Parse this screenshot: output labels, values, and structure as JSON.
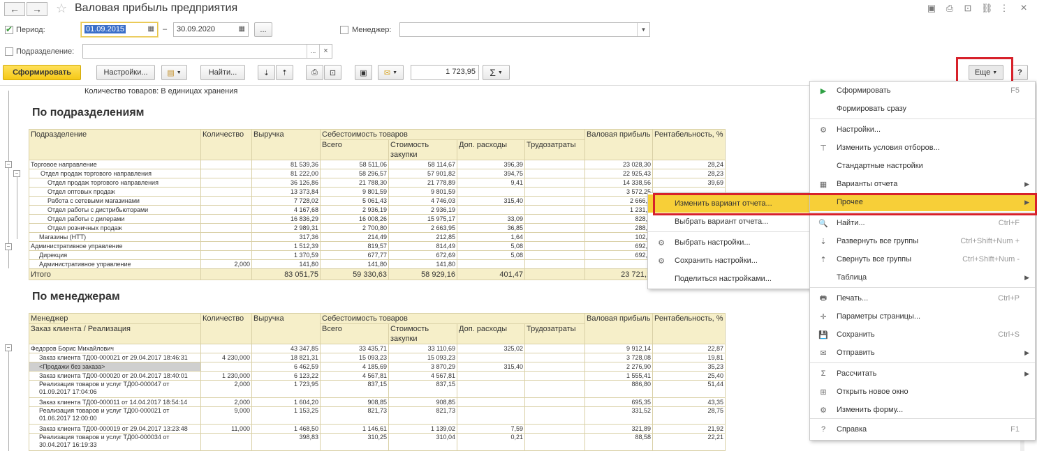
{
  "window": {
    "title": "Валовая прибыль предприятия"
  },
  "filters": {
    "period_label": "Период:",
    "date_from": "01.09.2015",
    "date_dash": "–",
    "date_to": "30.09.2020",
    "dots": "...",
    "manager_label": "Менеджер:",
    "manager_value": "",
    "division_label": "Подразделение:",
    "division_value": "",
    "clear": "×"
  },
  "toolbar": {
    "generate": "Сформировать",
    "settings": "Настройки...",
    "find": "Найти...",
    "sum_value": "1 723,95",
    "sigma": "Σ",
    "more": "Еще",
    "help": "?"
  },
  "report": {
    "note": "Количество товаров: В единицах хранения",
    "section1_title": "По подразделениям",
    "section2_title": "По менеджерам",
    "headers": {
      "division": "Подразделение",
      "manager": "Менеджер",
      "order": "Заказ клиента / Реализация",
      "qty": "Количество",
      "revenue": "Выручка",
      "cost": "Себестоимость товаров",
      "total": "Всего",
      "purchase": "Стоимость закупки",
      "extra": "Доп. расходы",
      "labor": "Трудозатраты",
      "gross": "Валовая прибыль",
      "profit": "Рентабельность, %"
    },
    "rows1": [
      {
        "lvl": "l0",
        "name": "Торговое направление",
        "qty": "",
        "rev": "81 539,36",
        "tot": "58 511,06",
        "pur": "58 114,67",
        "ext": "396,39",
        "lab": "",
        "gp": "23 028,30",
        "pct": "28,24"
      },
      {
        "lvl": "l1",
        "name": "Отдел продаж торгового направления",
        "qty": "",
        "rev": "81 222,00",
        "tot": "58 296,57",
        "pur": "57 901,82",
        "ext": "394,75",
        "lab": "",
        "gp": "22 925,43",
        "pct": "28,23"
      },
      {
        "lvl": "l2",
        "name": "Отдел продаж торгового направления",
        "qty": "",
        "rev": "36 126,86",
        "tot": "21 788,30",
        "pur": "21 778,89",
        "ext": "9,41",
        "lab": "",
        "gp": "14 338,56",
        "pct": "39,69"
      },
      {
        "lvl": "l2",
        "name": "Отдел оптовых продаж",
        "qty": "",
        "rev": "13 373,84",
        "tot": "9 801,59",
        "pur": "9 801,59",
        "ext": "",
        "lab": "",
        "gp": "3 572,25",
        "pct": ""
      },
      {
        "lvl": "l2",
        "name": "Работа с сетевыми магазинами",
        "qty": "",
        "rev": "7 728,02",
        "tot": "5 061,43",
        "pur": "4 746,03",
        "ext": "315,40",
        "lab": "",
        "gp": "2 666,5",
        "pct": ""
      },
      {
        "lvl": "l2",
        "name": "Отдел работы с дистрибьюторами",
        "qty": "",
        "rev": "4 167,68",
        "tot": "2 936,19",
        "pur": "2 936,19",
        "ext": "",
        "lab": "",
        "gp": "1 231,4",
        "pct": ""
      },
      {
        "lvl": "l2",
        "name": "Отдел работы с дилерами",
        "qty": "",
        "rev": "16 836,29",
        "tot": "16 008,26",
        "pur": "15 975,17",
        "ext": "33,09",
        "lab": "",
        "gp": "828,0",
        "pct": ""
      },
      {
        "lvl": "l2",
        "name": "Отдел розничных продаж",
        "qty": "",
        "rev": "2 989,31",
        "tot": "2 700,80",
        "pur": "2 663,95",
        "ext": "36,85",
        "lab": "",
        "gp": "288,5",
        "pct": ""
      },
      {
        "lvl": "l2b",
        "name": "Магазины (НТТ)",
        "qty": "",
        "rev": "317,36",
        "tot": "214,49",
        "pur": "212,85",
        "ext": "1,64",
        "lab": "",
        "gp": "102,8",
        "pct": ""
      },
      {
        "lvl": "l0",
        "name": "Административное управление",
        "qty": "",
        "rev": "1 512,39",
        "tot": "819,57",
        "pur": "814,49",
        "ext": "5,08",
        "lab": "",
        "gp": "692,8",
        "pct": ""
      },
      {
        "lvl": "l2b",
        "name": "Дирекция",
        "qty": "",
        "rev": "1 370,59",
        "tot": "677,77",
        "pur": "672,69",
        "ext": "5,08",
        "lab": "",
        "gp": "692,8",
        "pct": ""
      },
      {
        "lvl": "l2b",
        "name": "Административное управление",
        "qty": "2,000",
        "rev": "141,80",
        "tot": "141,80",
        "pur": "141,80",
        "ext": "",
        "lab": "",
        "gp": "",
        "pct": ""
      }
    ],
    "total1": {
      "name": "Итого",
      "qty": "",
      "rev": "83 051,75",
      "tot": "59 330,63",
      "pur": "58 929,16",
      "ext": "401,47",
      "lab": "",
      "gp": "23 721,1",
      "pct": ""
    },
    "rows2": [
      {
        "lvl": "l0",
        "cls": "",
        "name": "Федоров Борис Михайлович",
        "qty": "",
        "rev": "43 347,85",
        "tot": "33 435,71",
        "pur": "33 110,69",
        "ext": "325,02",
        "lab": "",
        "gp": "9 912,14",
        "pct": "22,87"
      },
      {
        "lvl": "l2b",
        "cls": "",
        "name": "Заказ клиента ТД00-000021 от 29.04.2017 18:46:31",
        "qty": "4 230,000",
        "rev": "18 821,31",
        "tot": "15 093,23",
        "pur": "15 093,23",
        "ext": "",
        "lab": "",
        "gp": "3 728,08",
        "pct": "19,81"
      },
      {
        "lvl": "l2b",
        "cls": "grey",
        "name": "<Продажи без заказа>",
        "qty": "",
        "rev": "6 462,59",
        "tot": "4 185,69",
        "pur": "3 870,29",
        "ext": "315,40",
        "lab": "",
        "gp": "2 276,90",
        "pct": "35,23"
      },
      {
        "lvl": "l2b",
        "cls": "",
        "name": "Заказ клиента ТД00-000020 от 20.04.2017 18:40:01",
        "qty": "1 230,000",
        "rev": "6 123,22",
        "tot": "4 567,81",
        "pur": "4 567,81",
        "ext": "",
        "lab": "",
        "gp": "1 555,41",
        "pct": "25,40"
      },
      {
        "lvl": "l2b",
        "cls": "tall",
        "name": "Реализация товаров и услуг ТД00-000047 от 01.09.2017 17:04:06",
        "qty": "2,000",
        "rev": "1 723,95",
        "tot": "837,15",
        "pur": "837,15",
        "ext": "",
        "lab": "",
        "gp": "886,80",
        "pct": "51,44"
      },
      {
        "lvl": "l2b",
        "cls": "",
        "name": "Заказ клиента ТД00-000011 от 14.04.2017 18:54:14",
        "qty": "2,000",
        "rev": "1 604,20",
        "tot": "908,85",
        "pur": "908,85",
        "ext": "",
        "lab": "",
        "gp": "695,35",
        "pct": "43,35"
      },
      {
        "lvl": "l2b",
        "cls": "tall",
        "name": "Реализация товаров и услуг ТД00-000021 от 01.06.2017 12:00:00",
        "qty": "9,000",
        "rev": "1 153,25",
        "tot": "821,73",
        "pur": "821,73",
        "ext": "",
        "lab": "",
        "gp": "331,52",
        "pct": "28,75"
      },
      {
        "lvl": "l2b",
        "cls": "",
        "name": "Заказ клиента ТД00-000019 от 29.04.2017 13:23:48",
        "qty": "11,000",
        "rev": "1 468,50",
        "tot": "1 146,61",
        "pur": "1 139,02",
        "ext": "7,59",
        "lab": "",
        "gp": "321,89",
        "pct": "21,92"
      },
      {
        "lvl": "l2b",
        "cls": "tall",
        "name": "Реализация товаров и услуг ТД00-000034 от 30.04.2017 16:19:33",
        "qty": "",
        "rev": "398,83",
        "tot": "310,25",
        "pur": "310,04",
        "ext": "0,21",
        "lab": "",
        "gp": "88,58",
        "pct": "22,21"
      }
    ]
  },
  "more_menu": [
    {
      "icon": "▶",
      "label": "Сформировать",
      "shortcut": "F5",
      "arrow": ""
    },
    {
      "icon": "",
      "label": "Формировать сразу",
      "shortcut": "",
      "arrow": ""
    },
    {
      "icon": "⚙",
      "label": "Настройки...",
      "shortcut": "",
      "arrow": ""
    },
    {
      "icon": "⊤",
      "label": "Изменить условия отборов...",
      "shortcut": "",
      "arrow": ""
    },
    {
      "icon": "",
      "label": "Стандартные настройки",
      "shortcut": "",
      "arrow": ""
    },
    {
      "icon": "▦",
      "label": "Варианты отчета",
      "shortcut": "",
      "arrow": "▶"
    },
    {
      "icon": "",
      "label": "Прочее",
      "shortcut": "",
      "arrow": "▶"
    },
    {
      "icon": "🔍",
      "label": "Найти...",
      "shortcut": "Ctrl+F",
      "arrow": ""
    },
    {
      "icon": "⇣",
      "label": "Развернуть все группы",
      "shortcut": "Ctrl+Shift+Num +",
      "arrow": ""
    },
    {
      "icon": "⇡",
      "label": "Свернуть все группы",
      "shortcut": "Ctrl+Shift+Num -",
      "arrow": ""
    },
    {
      "icon": "",
      "label": "Таблица",
      "shortcut": "",
      "arrow": "▶"
    },
    {
      "icon": "🖶",
      "label": "Печать...",
      "shortcut": "Ctrl+P",
      "arrow": ""
    },
    {
      "icon": "✛",
      "label": "Параметры страницы...",
      "shortcut": "",
      "arrow": ""
    },
    {
      "icon": "💾",
      "label": "Сохранить",
      "shortcut": "Ctrl+S",
      "arrow": ""
    },
    {
      "icon": "✉",
      "label": "Отправить",
      "shortcut": "",
      "arrow": "▶"
    },
    {
      "icon": "Σ",
      "label": "Рассчитать",
      "shortcut": "",
      "arrow": "▶"
    },
    {
      "icon": "⊞",
      "label": "Открыть новое окно",
      "shortcut": "",
      "arrow": ""
    },
    {
      "icon": "⚙",
      "label": "Изменить форму...",
      "shortcut": "",
      "arrow": ""
    },
    {
      "icon": "?",
      "label": "Справка",
      "shortcut": "F1",
      "arrow": ""
    }
  ],
  "sub_menu": [
    {
      "icon": "",
      "label": "Изменить вариант отчета..."
    },
    {
      "icon": "",
      "label": "Выбрать вариант отчета..."
    },
    {
      "icon": "⚙",
      "label": "Выбрать настройки..."
    },
    {
      "icon": "⚙",
      "label": "Сохранить настройки..."
    },
    {
      "icon": "",
      "label": "Поделиться настройками..."
    }
  ],
  "colors": {
    "accent": "#f7cf38",
    "highlight_box": "#d7212a",
    "header_bg": "#f6efc9"
  }
}
